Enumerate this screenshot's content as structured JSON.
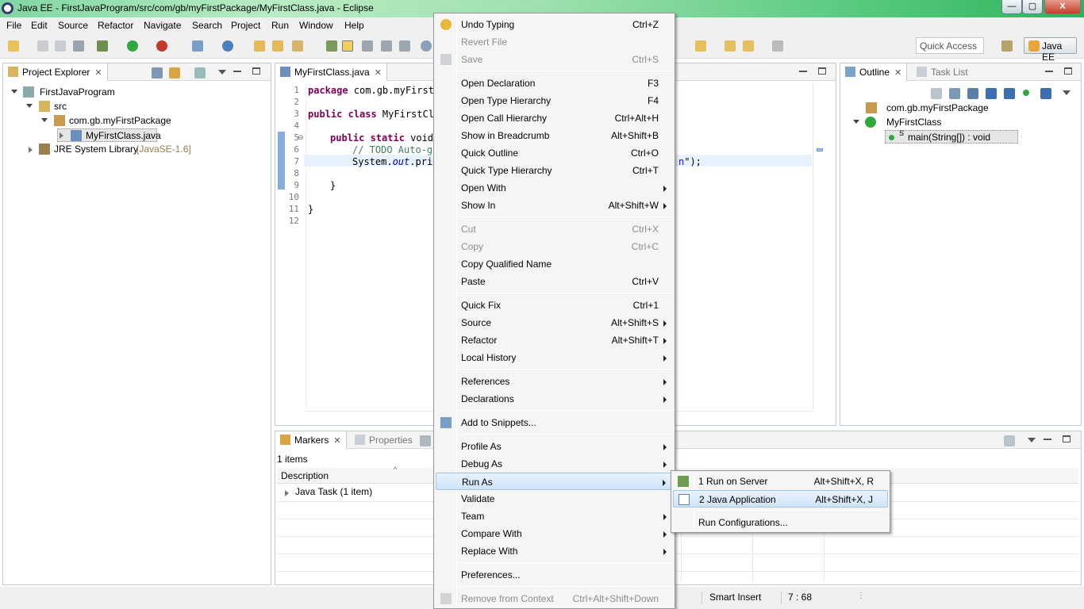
{
  "window": {
    "title": "Java EE - FirstJavaProgram/src/com/gb/myFirstPackage/MyFirstClass.java - Eclipse",
    "minimize": "—",
    "maximize": "▢",
    "close": "X"
  },
  "menubar": [
    "File",
    "Edit",
    "Source",
    "Refactor",
    "Navigate",
    "Search",
    "Project",
    "Run",
    "Window",
    "Help"
  ],
  "toolbar": {
    "quick_access_placeholder": "Quick Access",
    "perspective": "Java EE"
  },
  "project_explorer": {
    "tab": "Project Explorer",
    "tree": {
      "project": "FirstJavaProgram",
      "src": "src",
      "package": "com.gb.myFirstPackage",
      "file": "MyFirstClass.java",
      "jre": "JRE System Library",
      "jre_version": "[JavaSE-1.6]"
    }
  },
  "editor": {
    "tab": "MyFirstClass.java",
    "line_numbers": [
      "1",
      "2",
      "3",
      "4",
      "5",
      "6",
      "7",
      "8",
      "9",
      "10",
      "11",
      "12"
    ],
    "lines": {
      "l1_kw": "package",
      "l1_rest": " com.gb.myFirstP",
      "l3_kw": "public class",
      "l3_rest": " MyFirstCla",
      "l5_kw": "public static",
      "l5_rest": " void",
      "l6_comment": "// TODO Auto-ge",
      "l7_a": "System.",
      "l7_b": "out",
      "l7_c": ".prin",
      "l7_tail": "\");",
      "l9": "}",
      "l11": "}"
    }
  },
  "outline": {
    "tab": "Outline",
    "tab2": "Task List",
    "package": "com.gb.myFirstPackage",
    "class": "MyFirstClass",
    "method": "main(String[]) : void",
    "static_marker": "S"
  },
  "markers": {
    "tab": "Markers",
    "tab2": "Properties",
    "count": "1 items",
    "column": "Description",
    "row": "Java Task (1 item)"
  },
  "context_menu": {
    "items": [
      {
        "label": "Undo Typing",
        "accel": "Ctrl+Z"
      },
      {
        "label": "Revert File",
        "accel": ""
      },
      {
        "label": "Save",
        "accel": "Ctrl+S"
      },
      {
        "label": "Open Declaration",
        "accel": "F3"
      },
      {
        "label": "Open Type Hierarchy",
        "accel": "F4"
      },
      {
        "label": "Open Call Hierarchy",
        "accel": "Ctrl+Alt+H"
      },
      {
        "label": "Show in Breadcrumb",
        "accel": "Alt+Shift+B"
      },
      {
        "label": "Quick Outline",
        "accel": "Ctrl+O"
      },
      {
        "label": "Quick Type Hierarchy",
        "accel": "Ctrl+T"
      },
      {
        "label": "Open With",
        "accel": ""
      },
      {
        "label": "Show In",
        "accel": "Alt+Shift+W"
      },
      {
        "label": "Cut",
        "accel": "Ctrl+X"
      },
      {
        "label": "Copy",
        "accel": "Ctrl+C"
      },
      {
        "label": "Copy Qualified Name",
        "accel": ""
      },
      {
        "label": "Paste",
        "accel": "Ctrl+V"
      },
      {
        "label": "Quick Fix",
        "accel": "Ctrl+1"
      },
      {
        "label": "Source",
        "accel": "Alt+Shift+S"
      },
      {
        "label": "Refactor",
        "accel": "Alt+Shift+T"
      },
      {
        "label": "Local History",
        "accel": ""
      },
      {
        "label": "References",
        "accel": ""
      },
      {
        "label": "Declarations",
        "accel": ""
      },
      {
        "label": "Add to Snippets...",
        "accel": ""
      },
      {
        "label": "Profile As",
        "accel": ""
      },
      {
        "label": "Debug As",
        "accel": ""
      },
      {
        "label": "Run As",
        "accel": ""
      },
      {
        "label": "Validate",
        "accel": ""
      },
      {
        "label": "Team",
        "accel": ""
      },
      {
        "label": "Compare With",
        "accel": ""
      },
      {
        "label": "Replace With",
        "accel": ""
      },
      {
        "label": "Preferences...",
        "accel": ""
      },
      {
        "label": "Remove from Context",
        "accel": "Ctrl+Alt+Shift+Down"
      }
    ]
  },
  "run_as_submenu": {
    "items": [
      {
        "label": "1 Run on Server",
        "accel": "Alt+Shift+X, R"
      },
      {
        "label": "2 Java Application",
        "accel": "Alt+Shift+X, J"
      },
      {
        "label": "Run Configurations...",
        "accel": ""
      }
    ]
  },
  "statusbar": {
    "insert_mode": "Smart Insert",
    "position": "7 : 68"
  }
}
